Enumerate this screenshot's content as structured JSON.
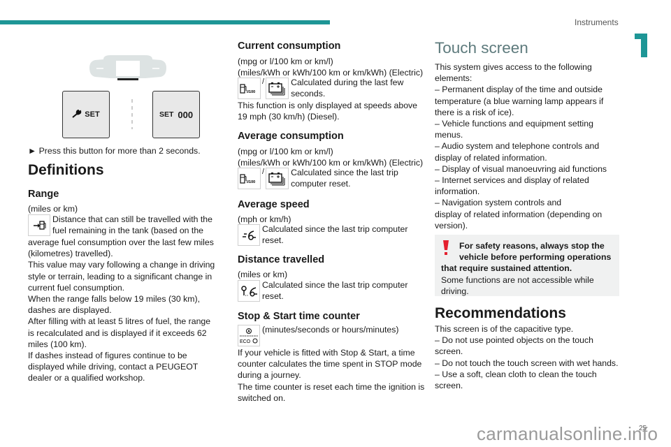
{
  "header": {
    "section": "Instruments",
    "chapter_number": "1",
    "accent_color": "#1e9696"
  },
  "illustration": {
    "left_button": {
      "icon": "wrench-icon",
      "label": "SET"
    },
    "right_button": {
      "label": "SET",
      "value": "000"
    }
  },
  "col1": {
    "instruction": "► Press this button for more than 2 seconds.",
    "definitions_title": "Definitions",
    "range": {
      "title": "Range",
      "units": "(miles or km)",
      "icon": "fuel-range-icon",
      "desc_lines": [
        "Distance that can still be travelled with the",
        "fuel remaining in the tank (based on the"
      ],
      "body_lines": [
        "average fuel consumption over the last few miles",
        "(kilometres) travelled).",
        "This value may vary following a change in driving",
        "style or terrain, leading to a significant change in",
        "current fuel consumption.",
        "When the range falls below 19 miles (30 km),",
        "dashes are displayed.",
        "After filling with at least 5 litres of fuel, the range",
        "is recalculated and is displayed if it exceeds 62",
        "miles (100 km).",
        "If dashes instead of figures continue to be",
        "displayed while driving, contact a PEUGEOT",
        "dealer or a qualified workshop."
      ]
    }
  },
  "col2": {
    "current": {
      "title": "Current consumption",
      "units1": "(mpg or l/100 km or km/l)",
      "units2": "(miles/kWh or kWh/100 km or km/kWh) (Electric)",
      "icon_sep": "/",
      "icon_fuel_label": "l/100",
      "desc_lines": [
        "Calculated during the last few",
        "seconds."
      ],
      "body_lines": [
        "This function is only displayed at speeds above",
        "19 mph (30 km/h) (Diesel)."
      ]
    },
    "average": {
      "title": "Average consumption",
      "units1": "(mpg or l/100 km or km/l)",
      "units2": "(miles/kWh or kWh/100 km or km/kWh) (Electric)",
      "icon_sep": "/",
      "icon_fuel_label": "l/100",
      "desc_lines": [
        "Calculated since the last trip",
        "computer reset."
      ]
    },
    "speed": {
      "title": "Average speed",
      "units": "(mph or km/h)",
      "desc_lines": [
        "Calculated since the last trip computer",
        "reset."
      ]
    },
    "distance": {
      "title": "Distance travelled",
      "units": "(miles or km)",
      "desc_lines": [
        "Calculated since the last trip computer",
        "reset."
      ]
    },
    "stopstart": {
      "title": "Stop & Start time counter",
      "icon_label": "ECO",
      "units": "(minutes/seconds or hours/minutes)",
      "body_lines": [
        "If your vehicle is fitted with Stop & Start, a time",
        "counter calculates the time spent in STOP mode",
        "during a journey.",
        "The time counter is reset each time the ignition is",
        "switched on."
      ]
    }
  },
  "col3": {
    "title": "Touch screen",
    "body_lines": [
      "This system gives access to the following",
      "elements:",
      "–  Permanent display of the time and outside",
      "temperature (a blue warning lamp appears if",
      "there is a risk of ice).",
      "–  Vehicle functions and equipment setting",
      "menus.",
      "–  Audio system and telephone controls and",
      "display of related information.",
      "–  Display of visual manoeuvring aid functions",
      "–  Internet services and display of related",
      "information.",
      "–  Navigation system controls and",
      "display of related information (depending on",
      "version)."
    ],
    "warning": {
      "bold_lines": [
        "For safety reasons, always stop the",
        "vehicle before performing operations",
        "that require sustained attention."
      ],
      "lines": [
        "Some functions are not accessible while",
        "driving."
      ],
      "color": "#e4202f"
    },
    "recommendations": {
      "title": "Recommendations",
      "lines": [
        "This screen is of the capacitive type.",
        "–  Do not use pointed objects on the touch",
        "screen.",
        "–  Do not touch the touch screen with wet hands.",
        "–  Use a soft, clean cloth to clean the touch",
        "screen."
      ]
    }
  },
  "footer": {
    "page_number": "25",
    "watermark": "carmanualsonline.info"
  }
}
